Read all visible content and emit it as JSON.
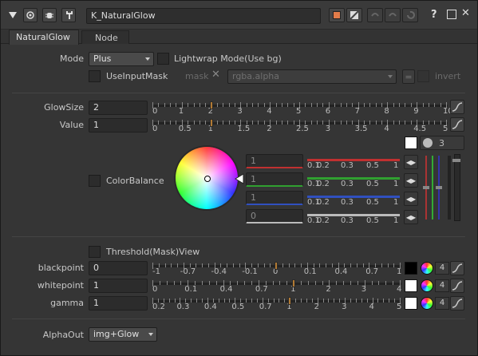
{
  "header": {
    "node_name": "K_NaturalGlow",
    "help_icon": "question-icon"
  },
  "tabs": [
    {
      "label": "NaturalGlow",
      "active": true
    },
    {
      "label": "Node",
      "active": false
    }
  ],
  "mode": {
    "label": "Mode",
    "value": "Plus"
  },
  "lightwrap": {
    "label": "Lightwrap Mode(Use bg)",
    "checked": false
  },
  "useinputmask": {
    "label": "UseInputMask",
    "checked": false
  },
  "mask": {
    "label": "mask",
    "channel": "rgba.alpha",
    "eq": "=",
    "invert_label": "invert"
  },
  "glowsize": {
    "label": "GlowSize",
    "value": "2",
    "slider_value": 2,
    "ticks": [
      "0",
      "1",
      "2",
      "3",
      "4",
      "5",
      "6",
      "7",
      "8",
      "9",
      "10"
    ]
  },
  "value": {
    "label": "Value",
    "value": "1",
    "slider_value": 1,
    "ticks": [
      "0",
      "0.5",
      "1",
      "1.5",
      "2",
      "2.5",
      "3",
      "3.5",
      "4",
      "4.5",
      "5"
    ]
  },
  "colorbalance": {
    "label": "ColorBalance",
    "checked": false,
    "swatch_count": "3",
    "channels": [
      {
        "name": "red",
        "value": "1",
        "color": "#c03030"
      },
      {
        "name": "green",
        "value": "1",
        "color": "#30a030"
      },
      {
        "name": "blue",
        "value": "1",
        "color": "#3050c0"
      },
      {
        "name": "alpha",
        "value": "0",
        "color": "#bbbbbb"
      }
    ],
    "ticks": [
      "0.1",
      "0.2",
      "0.3",
      "0.5",
      "1"
    ]
  },
  "threshold": {
    "label": "Threshold(Mask)View",
    "checked": false
  },
  "blackpoint": {
    "label": "blackpoint",
    "value": "0",
    "count": "4",
    "ticks": [
      "-1",
      "-0.7",
      "-0.4",
      "-0.1",
      "0",
      "0.1",
      "0.4",
      "0.7",
      "1"
    ]
  },
  "whitepoint": {
    "label": "whitepoint",
    "value": "1",
    "count": "4",
    "ticks": [
      "0",
      "0.1",
      "0.4",
      "0.7",
      "1",
      "2",
      "3",
      "4"
    ]
  },
  "gamma": {
    "label": "gamma",
    "value": "1",
    "count": "4",
    "ticks": [
      "0.2",
      "0.3",
      "0.4",
      "0.5",
      "0.7",
      "1",
      "2",
      "3",
      "4",
      "5"
    ]
  },
  "alphaout": {
    "label": "AlphaOut",
    "value": "img+Glow"
  }
}
